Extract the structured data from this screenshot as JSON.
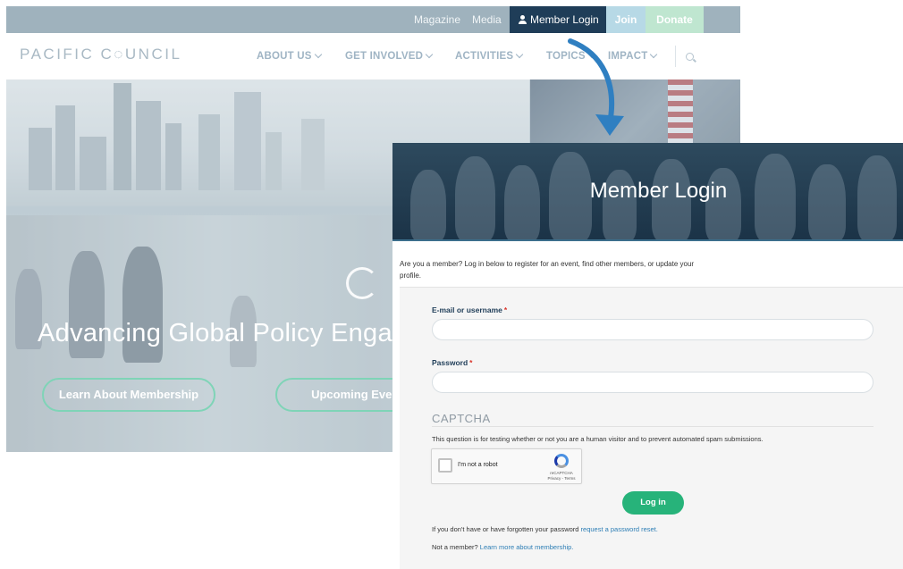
{
  "site": {
    "logo": "PACIFIC C◌UNCIL",
    "topbar": {
      "magazine": "Magazine",
      "media": "Media",
      "member_login": "Member Login",
      "join": "Join",
      "donate": "Donate"
    },
    "nav": {
      "about": "ABOUT US",
      "involved": "GET INVOLVED",
      "activities": "ACTIVITIES",
      "topics": "TOPICS",
      "impact": "IMPACT"
    },
    "hero": {
      "heading": "Advancing Global Policy Engagement",
      "membership_button": "Learn About Membership",
      "events_button": "Upcoming Events"
    }
  },
  "login_page": {
    "title": "Member Login",
    "intro": "Are you a member? Log in below to register for an event, find other members, or update your profile.",
    "email_label": "E-mail or username",
    "password_label": "Password",
    "required_marker": "*",
    "captcha_title": "CAPTCHA",
    "captcha_desc": "This question is for testing whether or not you are a human visitor and to prevent automated spam submissions.",
    "recaptcha_label": "I'm not a robot",
    "recaptcha_brand": "reCAPTCHA",
    "recaptcha_terms": "Privacy - Terms",
    "login_button": "Log in",
    "forgot_text": "If you don't have or have forgotten your password ",
    "forgot_link": "request a password reset.",
    "member_text": "Not a member? ",
    "member_link": "Learn more about membership."
  },
  "colors": {
    "topbar": "#9fb2bd",
    "login_tab": "#1f3d58",
    "join": "#b7d9e6",
    "donate": "#bfe6d0",
    "accent_green": "#27b37a",
    "link_blue": "#2d7eb5",
    "arrow_blue": "#2f7fc1"
  }
}
